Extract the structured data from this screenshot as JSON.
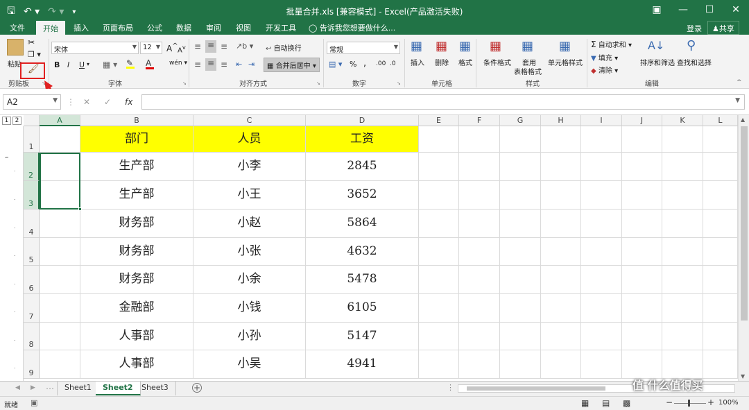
{
  "titlebar": {
    "title": "批量合并.xls  [兼容模式] - Excel(产品激活失败)"
  },
  "menu": {
    "tabs": [
      "文件",
      "开始",
      "插入",
      "页面布局",
      "公式",
      "数据",
      "审阅",
      "视图",
      "开发工具"
    ],
    "active_tab": "开始",
    "tell_me": "告诉我您想要做什么...",
    "login": "登录",
    "share": "共享"
  },
  "ribbon": {
    "clipboard": {
      "label": "剪贴板",
      "paste": "粘贴"
    },
    "font": {
      "label": "字体",
      "font_name": "宋体",
      "font_size": "12",
      "bold": "B",
      "italic": "I",
      "underline": "U"
    },
    "alignment": {
      "label": "对齐方式",
      "wrap": "自动换行",
      "merge": "合并后居中"
    },
    "number": {
      "label": "数字",
      "format": "常规",
      "percent": "%",
      "comma": ","
    },
    "cells": {
      "label": "单元格",
      "insert": "插入",
      "delete": "删除",
      "format": "格式"
    },
    "styles": {
      "label": "样式",
      "cond": "条件格式",
      "table1": "套用",
      "table2": "表格格式",
      "cellstyle": "单元格样式"
    },
    "editing": {
      "label": "编辑",
      "autosum": "自动求和",
      "fill": "填充",
      "clear": "清除",
      "sort": "排序和筛选",
      "find": "查找和选择"
    }
  },
  "formula_bar": {
    "name_box": "A2",
    "fx": "fx",
    "value": ""
  },
  "grid": {
    "columns": [
      "A",
      "B",
      "C",
      "D",
      "E",
      "F",
      "G",
      "H",
      "I",
      "J",
      "K",
      "L"
    ],
    "rows": [
      "1",
      "2",
      "3",
      "4",
      "5",
      "6",
      "7",
      "8",
      "9"
    ],
    "outline_levels": [
      "1",
      "2"
    ],
    "header": [
      "部门",
      "人员",
      "工资"
    ],
    "data": [
      [
        "生产部",
        "小李",
        "2845"
      ],
      [
        "生产部",
        "小王",
        "3652"
      ],
      [
        "财务部",
        "小赵",
        "5864"
      ],
      [
        "财务部",
        "小张",
        "4632"
      ],
      [
        "财务部",
        "小余",
        "5478"
      ],
      [
        "金融部",
        "小钱",
        "6105"
      ],
      [
        "人事部",
        "小孙",
        "5147"
      ],
      [
        "人事部",
        "小吴",
        "4941"
      ]
    ],
    "highlight_color": "#ffff00"
  },
  "sheets": {
    "tabs": [
      "Sheet1",
      "Sheet2",
      "Sheet3"
    ],
    "active": "Sheet2"
  },
  "status": {
    "mode": "就绪",
    "zoom": "100%"
  },
  "watermark": "值 什么值得买",
  "accent": "#217346"
}
